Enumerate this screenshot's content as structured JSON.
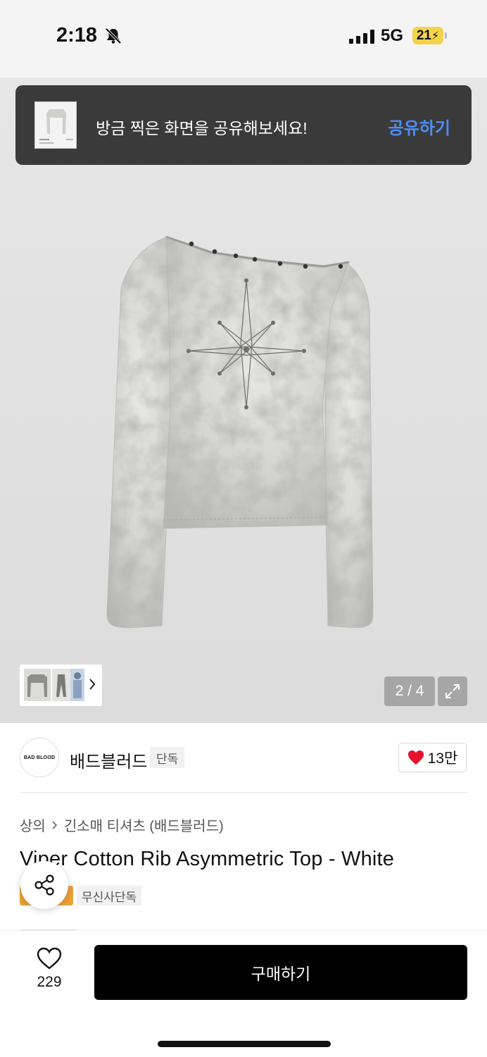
{
  "status_bar": {
    "time": "2:18",
    "network": "5G",
    "battery": "21"
  },
  "toast": {
    "message": "방금 찍은 화면을 공유해보세요!",
    "action": "공유하기"
  },
  "gallery": {
    "counter": "2 / 4"
  },
  "brand": {
    "logo_text": "BAD BLOOD",
    "name": "배드블러드",
    "badge": "단독",
    "likes": "13만"
  },
  "breadcrumb": {
    "category": "상의",
    "subcategory": "긴소매 티셔츠 (배드블러드)"
  },
  "product": {
    "title": "Viper Cotton Rib Asymmetric Top - White",
    "tag": "무신사단독"
  },
  "bottom_bar": {
    "wish_count": "229",
    "buy_label": "구매하기"
  },
  "colors": {
    "accent_blue": "#4e8df5",
    "heart_red": "#e8112d",
    "tag_orange": "#e9a23b"
  }
}
